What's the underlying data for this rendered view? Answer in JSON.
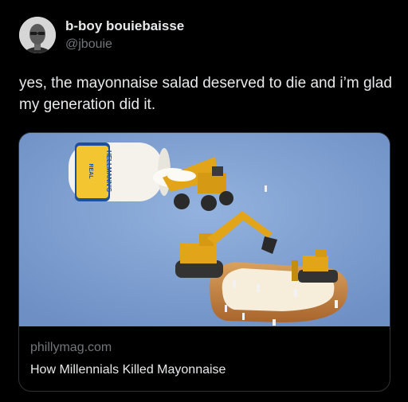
{
  "author": {
    "display_name": "b-boy bouiebaisse",
    "handle": "@jbouie"
  },
  "tweet": {
    "text": "yes, the mayonnaise salad deserved to die and i’m glad my generation did it."
  },
  "card": {
    "domain": "phillymag.com",
    "headline": "How Millennials Killed Mayonnaise",
    "image_jar_label": "HELLMANN'S",
    "image_jar_sublabel": "REAL"
  },
  "colors": {
    "background": "#000000",
    "text_primary": "#e7e9ea",
    "text_secondary": "#71767b",
    "card_border": "#2f3336",
    "image_sky": "#7e9fd1",
    "machine_yellow": "#e2a51a"
  }
}
